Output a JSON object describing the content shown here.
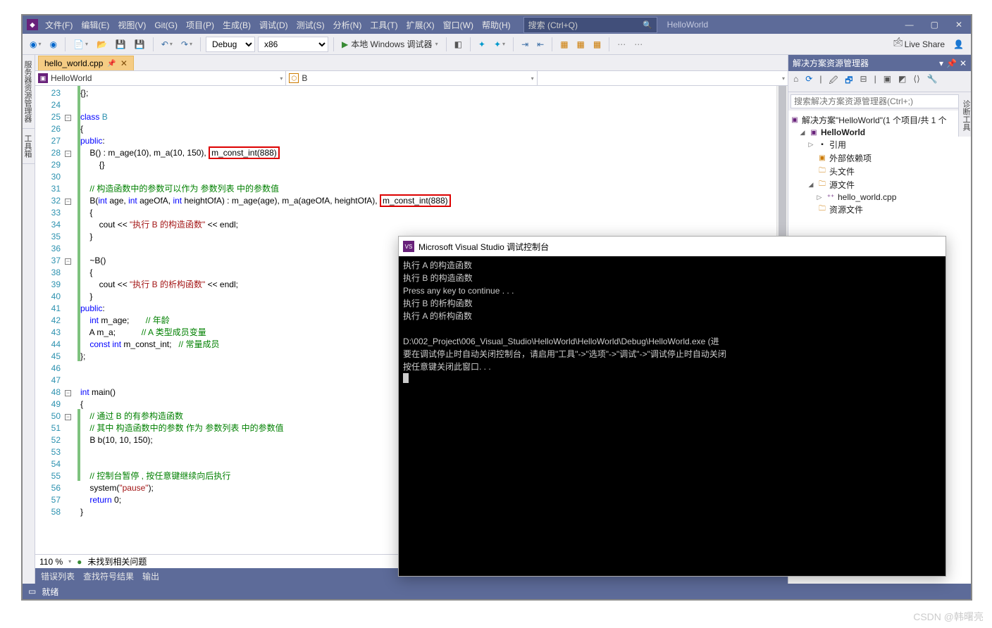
{
  "menus": [
    "文件(F)",
    "编辑(E)",
    "视图(V)",
    "Git(G)",
    "项目(P)",
    "生成(B)",
    "调试(D)",
    "测试(S)",
    "分析(N)",
    "工具(T)",
    "扩展(X)",
    "窗口(W)",
    "帮助(H)"
  ],
  "search_placeholder": "搜索 (Ctrl+Q)",
  "app_name": "HelloWorld",
  "toolbar": {
    "config": "Debug",
    "platform": "x86",
    "run_label": "本地 Windows 调试器",
    "live_share": "Live Share"
  },
  "left_tabs": [
    "服务器资源管理器",
    "工具箱"
  ],
  "right_tab": "诊断工具",
  "file_tab": "hello_world.cpp",
  "nav": {
    "proj": "HelloWorld",
    "class": "B"
  },
  "code_lines": [
    {
      "n": 23,
      "ol": "",
      "chg": 1,
      "html": "{};"
    },
    {
      "n": 24,
      "ol": "",
      "chg": 1,
      "html": ""
    },
    {
      "n": 25,
      "ol": "-",
      "chg": 1,
      "html": "<span class='kw'>class</span> <span class='type'>B</span>"
    },
    {
      "n": 26,
      "ol": "",
      "chg": 1,
      "html": "{"
    },
    {
      "n": 27,
      "ol": "",
      "chg": 1,
      "html": "<span class='kw'>public</span>:"
    },
    {
      "n": 28,
      "ol": "-",
      "chg": 1,
      "html": "    B() : m_age(10), m_a(10, 150), <span class='hlbox'>m_const_int(888)</span>"
    },
    {
      "n": 29,
      "ol": "",
      "chg": 1,
      "html": "        {}"
    },
    {
      "n": 30,
      "ol": "",
      "chg": 1,
      "html": ""
    },
    {
      "n": 31,
      "ol": "",
      "chg": 1,
      "html": "    <span class='cmt'>// 构造函数中的参数可以作为 参数列表 中的参数值</span>"
    },
    {
      "n": 32,
      "ol": "-",
      "chg": 1,
      "html": "    B(<span class='kw'>int</span> age, <span class='kw'>int</span> ageOfA, <span class='kw'>int</span> heightOfA) : m_age(age), m_a(ageOfA, heightOfA), <span class='hlbox'>m_const_int(888)</span>"
    },
    {
      "n": 33,
      "ol": "",
      "chg": 1,
      "html": "    {"
    },
    {
      "n": 34,
      "ol": "",
      "chg": 1,
      "html": "        cout &lt;&lt; <span class='str'>\"执行 B 的构造函数\"</span> &lt;&lt; endl;"
    },
    {
      "n": 35,
      "ol": "",
      "chg": 1,
      "html": "    }"
    },
    {
      "n": 36,
      "ol": "",
      "chg": 1,
      "html": ""
    },
    {
      "n": 37,
      "ol": "-",
      "chg": 1,
      "html": "    ~B()"
    },
    {
      "n": 38,
      "ol": "",
      "chg": 1,
      "html": "    {"
    },
    {
      "n": 39,
      "ol": "",
      "chg": 1,
      "html": "        cout &lt;&lt; <span class='str'>\"执行 B 的析构函数\"</span> &lt;&lt; endl;"
    },
    {
      "n": 40,
      "ol": "",
      "chg": 1,
      "html": "    }"
    },
    {
      "n": 41,
      "ol": "",
      "chg": 1,
      "html": "<span class='kw'>public</span>:"
    },
    {
      "n": 42,
      "ol": "",
      "chg": 1,
      "html": "    <span class='kw'>int</span> m_age;       <span class='cmt'>// 年龄</span>"
    },
    {
      "n": 43,
      "ol": "",
      "chg": 1,
      "html": "    A m_a;           <span class='cmt'>// A 类型成员变量</span>"
    },
    {
      "n": 44,
      "ol": "",
      "chg": 1,
      "html": "    <span class='kw'>const</span> <span class='kw'>int</span> m_const_int;   <span class='cmt'>// 常量成员</span>"
    },
    {
      "n": 45,
      "ol": "",
      "chg": 1,
      "html": "};"
    },
    {
      "n": 46,
      "ol": "",
      "chg": 0,
      "html": ""
    },
    {
      "n": 47,
      "ol": "",
      "chg": 0,
      "html": ""
    },
    {
      "n": 48,
      "ol": "-",
      "chg": 0,
      "html": "<span class='kw'>int</span> main()"
    },
    {
      "n": 49,
      "ol": "",
      "chg": 0,
      "html": "{"
    },
    {
      "n": 50,
      "ol": "-",
      "chg": 1,
      "html": "    <span class='cmt'>// 通过 B 的有参构造函数</span>"
    },
    {
      "n": 51,
      "ol": "",
      "chg": 1,
      "html": "    <span class='cmt'>// 其中 构造函数中的参数 作为 参数列表 中的参数值</span>"
    },
    {
      "n": 52,
      "ol": "",
      "chg": 1,
      "html": "    B b(10, 10, 150);"
    },
    {
      "n": 53,
      "ol": "",
      "chg": 1,
      "html": ""
    },
    {
      "n": 54,
      "ol": "",
      "chg": 1,
      "html": ""
    },
    {
      "n": 55,
      "ol": "",
      "chg": 1,
      "html": "    <span class='cmt'>// 控制台暂停 , 按任意键继续向后执行</span>"
    },
    {
      "n": 56,
      "ol": "",
      "chg": 0,
      "html": "    system(<span class='str'>\"pause\"</span>);"
    },
    {
      "n": 57,
      "ol": "",
      "chg": 0,
      "html": "    <span class='kw'>return</span> 0;"
    },
    {
      "n": 58,
      "ol": "",
      "chg": 0,
      "html": "}"
    }
  ],
  "zoom": "110 %",
  "issues": "未找到相关问题",
  "bottom_tabs": [
    "错误列表",
    "查找符号结果",
    "输出"
  ],
  "status": "就绪",
  "solution": {
    "title": "解决方案资源管理器",
    "search": "搜索解决方案资源管理器(Ctrl+;)",
    "root": "解决方案\"HelloWorld\"(1 个项目/共 1 个",
    "project": "HelloWorld",
    "nodes": [
      "引用",
      "外部依赖项",
      "头文件",
      "源文件",
      "hello_world.cpp",
      "资源文件"
    ]
  },
  "console": {
    "title": "Microsoft Visual Studio 调试控制台",
    "lines": [
      "执行 A 的构造函数",
      "执行 B 的构造函数",
      "Press any key to continue . . .",
      "执行 B 的析构函数",
      "执行 A 的析构函数",
      "",
      "D:\\002_Project\\006_Visual_Studio\\HelloWorld\\HelloWorld\\Debug\\HelloWorld.exe (进",
      "要在调试停止时自动关闭控制台，请启用\"工具\"->\"选项\"->\"调试\"->\"调试停止时自动关闭",
      "按任意键关闭此窗口. . ."
    ]
  },
  "watermark": "CSDN @韩曙亮"
}
